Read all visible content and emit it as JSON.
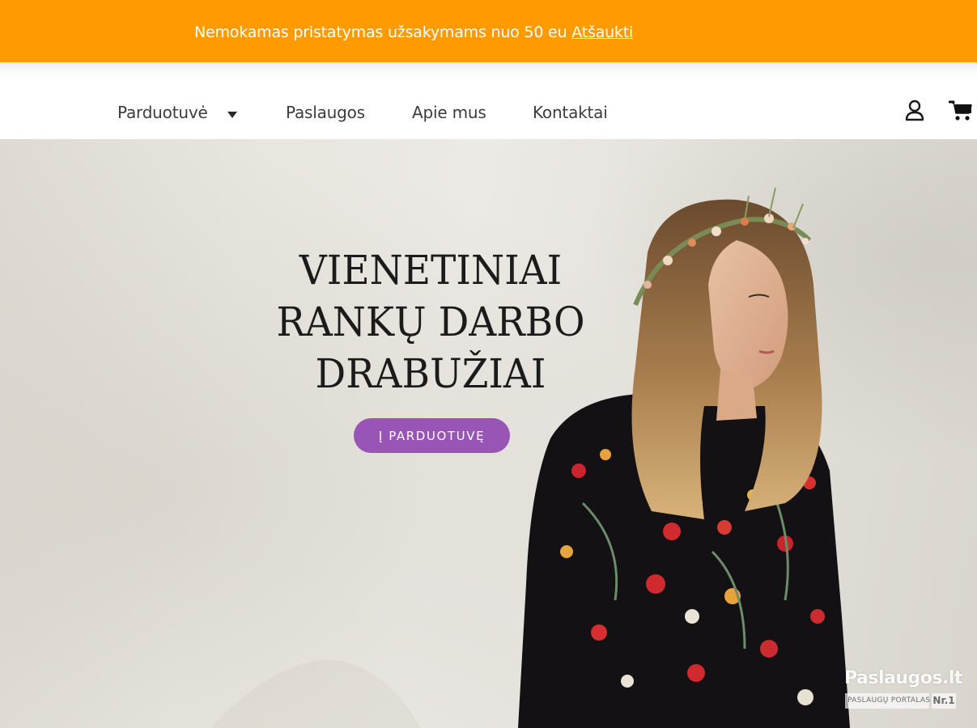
{
  "promo": {
    "text": "Nemokamas pristatymas užsakymams nuo 50 eu",
    "link": "Atšaukti"
  },
  "nav": {
    "items": [
      {
        "label": "Parduotuvė",
        "has_dropdown": true
      },
      {
        "label": "Paslaugos"
      },
      {
        "label": "Apie mus"
      },
      {
        "label": "Kontaktai"
      }
    ],
    "icons": [
      "user-account-icon",
      "shopping-cart-icon"
    ]
  },
  "hero": {
    "title_lines": [
      "VIENETINIAI",
      "RANKŲ DARBO",
      "DRABUŽIAI"
    ],
    "cta_label": "Į PARDUOTUVĘ"
  },
  "watermark": {
    "brand": "Paslaugos.lt",
    "subtitle": "PASLAUGŲ PORTALAS",
    "badge": "Nr.1"
  },
  "colors": {
    "promo_bar": "#ff9a00",
    "cta_button": "#9855b5",
    "nav_text": "#3c3c3c",
    "hero_title": "#1b1b1b"
  }
}
